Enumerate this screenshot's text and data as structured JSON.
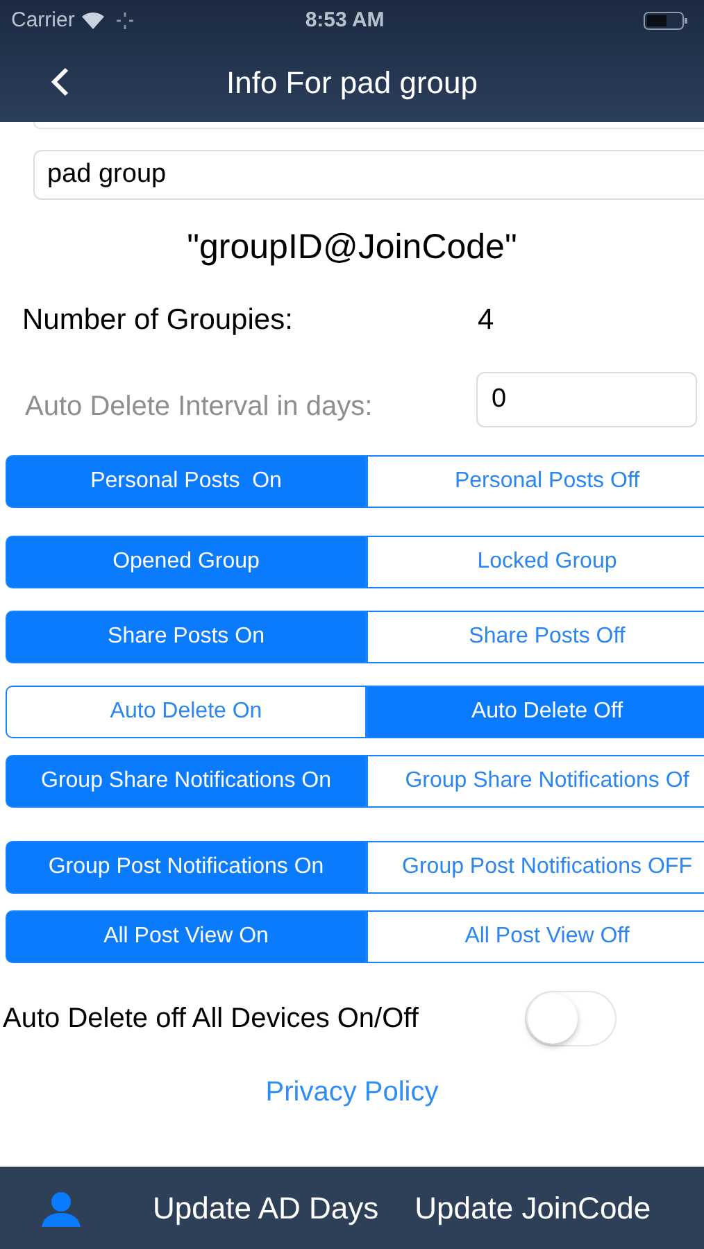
{
  "status_bar": {
    "carrier": "Carrier",
    "time": "8:53 AM"
  },
  "nav_bar": {
    "title": "Info For pad group"
  },
  "group_name_field": {
    "value": "pad group"
  },
  "join_code_hint": "\"groupID@JoinCode\"",
  "groupies": {
    "label": "Number of Groupies:",
    "value": "4"
  },
  "auto_delete_interval": {
    "label": "Auto Delete Interval in days:",
    "value": "0"
  },
  "segmented_controls": [
    {
      "segments": [
        {
          "label": "Personal Posts  On",
          "selected": true
        },
        {
          "label": "Personal Posts Off",
          "selected": false
        }
      ]
    },
    {
      "segments": [
        {
          "label": "Opened Group",
          "selected": true
        },
        {
          "label": "Locked Group",
          "selected": false
        }
      ]
    },
    {
      "segments": [
        {
          "label": "Share Posts On",
          "selected": true
        },
        {
          "label": "Share Posts Off",
          "selected": false
        }
      ]
    },
    {
      "segments": [
        {
          "label": "Auto Delete On",
          "selected": false
        },
        {
          "label": "Auto Delete Off",
          "selected": true
        }
      ]
    },
    {
      "segments": [
        {
          "label": "Group Share Notifications On",
          "selected": true
        },
        {
          "label": "Group Share Notifications Of",
          "selected": false
        }
      ]
    },
    {
      "segments": [
        {
          "label": "Group Post Notifications On",
          "selected": true
        },
        {
          "label": "Group Post Notifications OFF",
          "selected": false
        }
      ]
    },
    {
      "segments": [
        {
          "label": "All Post View On",
          "selected": true
        },
        {
          "label": "All Post View Off",
          "selected": false
        }
      ]
    }
  ],
  "all_devices_toggle": {
    "label": "Auto Delete off All Devices On/Off",
    "on": false
  },
  "privacy_link": "Privacy Policy",
  "bottom_bar": {
    "buttons": [
      "Update AD Days",
      "Update JoinCode"
    ]
  }
}
